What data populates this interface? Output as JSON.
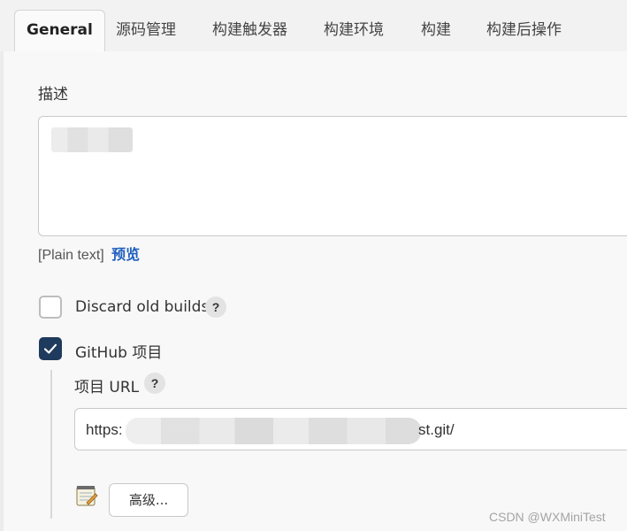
{
  "tabs": [
    {
      "label": "General",
      "active": true
    },
    {
      "label": "源码管理"
    },
    {
      "label": "构建触发器"
    },
    {
      "label": "构建环境"
    },
    {
      "label": "构建"
    },
    {
      "label": "构建后操作"
    }
  ],
  "description": {
    "label": "描述",
    "format_label": "[Plain text]",
    "preview_label": "预览"
  },
  "options": {
    "discard_old_builds": {
      "label": "Discard old builds",
      "checked": false,
      "help": "?"
    },
    "github_project": {
      "label": "GitHub 项目",
      "checked": true
    }
  },
  "project_url": {
    "label": "项目 URL",
    "help": "?",
    "value_prefix": "https:",
    "value_suffix": "st.git/"
  },
  "advanced_button": {
    "label": "高级..."
  },
  "watermark": "CSDN @WXMiniTest",
  "colors": {
    "checkbox_checked": "#1e3a5c",
    "link": "#1f5fbf"
  },
  "icons": {
    "check": "check-icon",
    "notepad": "notepad-icon",
    "help": "help-icon"
  }
}
